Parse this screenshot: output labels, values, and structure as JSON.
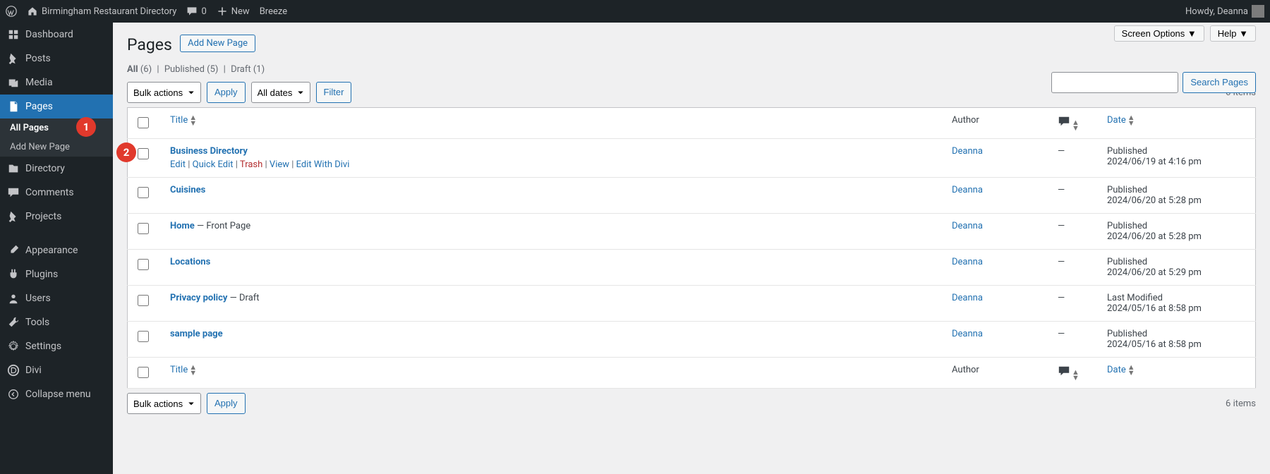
{
  "adminbar": {
    "site_title": "Birmingham Restaurant Directory",
    "comments_count": "0",
    "new_label": "New",
    "breeze_label": "Breeze",
    "howdy": "Howdy, Deanna"
  },
  "adminmenu": {
    "items": [
      {
        "id": "dashboard",
        "label": "Dashboard",
        "icon": "dashboard"
      },
      {
        "id": "posts",
        "label": "Posts",
        "icon": "pin"
      },
      {
        "id": "media",
        "label": "Media",
        "icon": "media"
      },
      {
        "id": "pages",
        "label": "Pages",
        "icon": "pages",
        "current": true
      },
      {
        "id": "directory",
        "label": "Directory",
        "icon": "directory"
      },
      {
        "id": "comments",
        "label": "Comments",
        "icon": "comment"
      },
      {
        "id": "projects",
        "label": "Projects",
        "icon": "pin"
      },
      {
        "id": "appearance",
        "label": "Appearance",
        "icon": "brush"
      },
      {
        "id": "plugins",
        "label": "Plugins",
        "icon": "plug"
      },
      {
        "id": "users",
        "label": "Users",
        "icon": "user"
      },
      {
        "id": "tools",
        "label": "Tools",
        "icon": "tools"
      },
      {
        "id": "settings",
        "label": "Settings",
        "icon": "settings"
      },
      {
        "id": "divi",
        "label": "Divi",
        "icon": "divi"
      },
      {
        "id": "collapse",
        "label": "Collapse menu",
        "icon": "collapse"
      }
    ],
    "submenu": [
      {
        "label": "All Pages",
        "current": true
      },
      {
        "label": "Add New Page"
      }
    ]
  },
  "header": {
    "title": "Pages",
    "add_new": "Add New Page",
    "screen_options": "Screen Options",
    "help": "Help"
  },
  "filters": {
    "all_label": "All",
    "all_count": "(6)",
    "published_label": "Published",
    "published_count": "(5)",
    "draft_label": "Draft",
    "draft_count": "(1)",
    "bulk_action": "Bulk actions",
    "apply": "Apply",
    "all_dates": "All dates",
    "filter": "Filter",
    "items": "6 items",
    "search_btn": "Search Pages"
  },
  "columns": {
    "title": "Title",
    "author": "Author",
    "date": "Date"
  },
  "row_actions": {
    "edit": "Edit",
    "quick": "Quick Edit",
    "trash": "Trash",
    "view": "View",
    "divi": "Edit With Divi"
  },
  "pages": [
    {
      "title": "Business Directory",
      "suffix": "",
      "author": "Deanna",
      "comments": "—",
      "status": "Published",
      "date": "2024/06/19 at 4:16 pm",
      "show_actions": true
    },
    {
      "title": "Cuisines",
      "suffix": "",
      "author": "Deanna",
      "comments": "—",
      "status": "Published",
      "date": "2024/06/20 at 5:28 pm"
    },
    {
      "title": "Home",
      "suffix": " — Front Page",
      "author": "Deanna",
      "comments": "—",
      "status": "Published",
      "date": "2024/06/20 at 5:28 pm"
    },
    {
      "title": "Locations",
      "suffix": "",
      "author": "Deanna",
      "comments": "—",
      "status": "Published",
      "date": "2024/06/20 at 5:29 pm"
    },
    {
      "title": "Privacy policy",
      "suffix": " — Draft",
      "author": "Deanna",
      "comments": "—",
      "status": "Last Modified",
      "date": "2024/05/16 at 8:58 pm"
    },
    {
      "title": "sample page",
      "suffix": "",
      "author": "Deanna",
      "comments": "—",
      "status": "Published",
      "date": "2024/05/16 at 8:58 pm"
    }
  ],
  "annotations": {
    "a1": "1",
    "a2": "2"
  }
}
